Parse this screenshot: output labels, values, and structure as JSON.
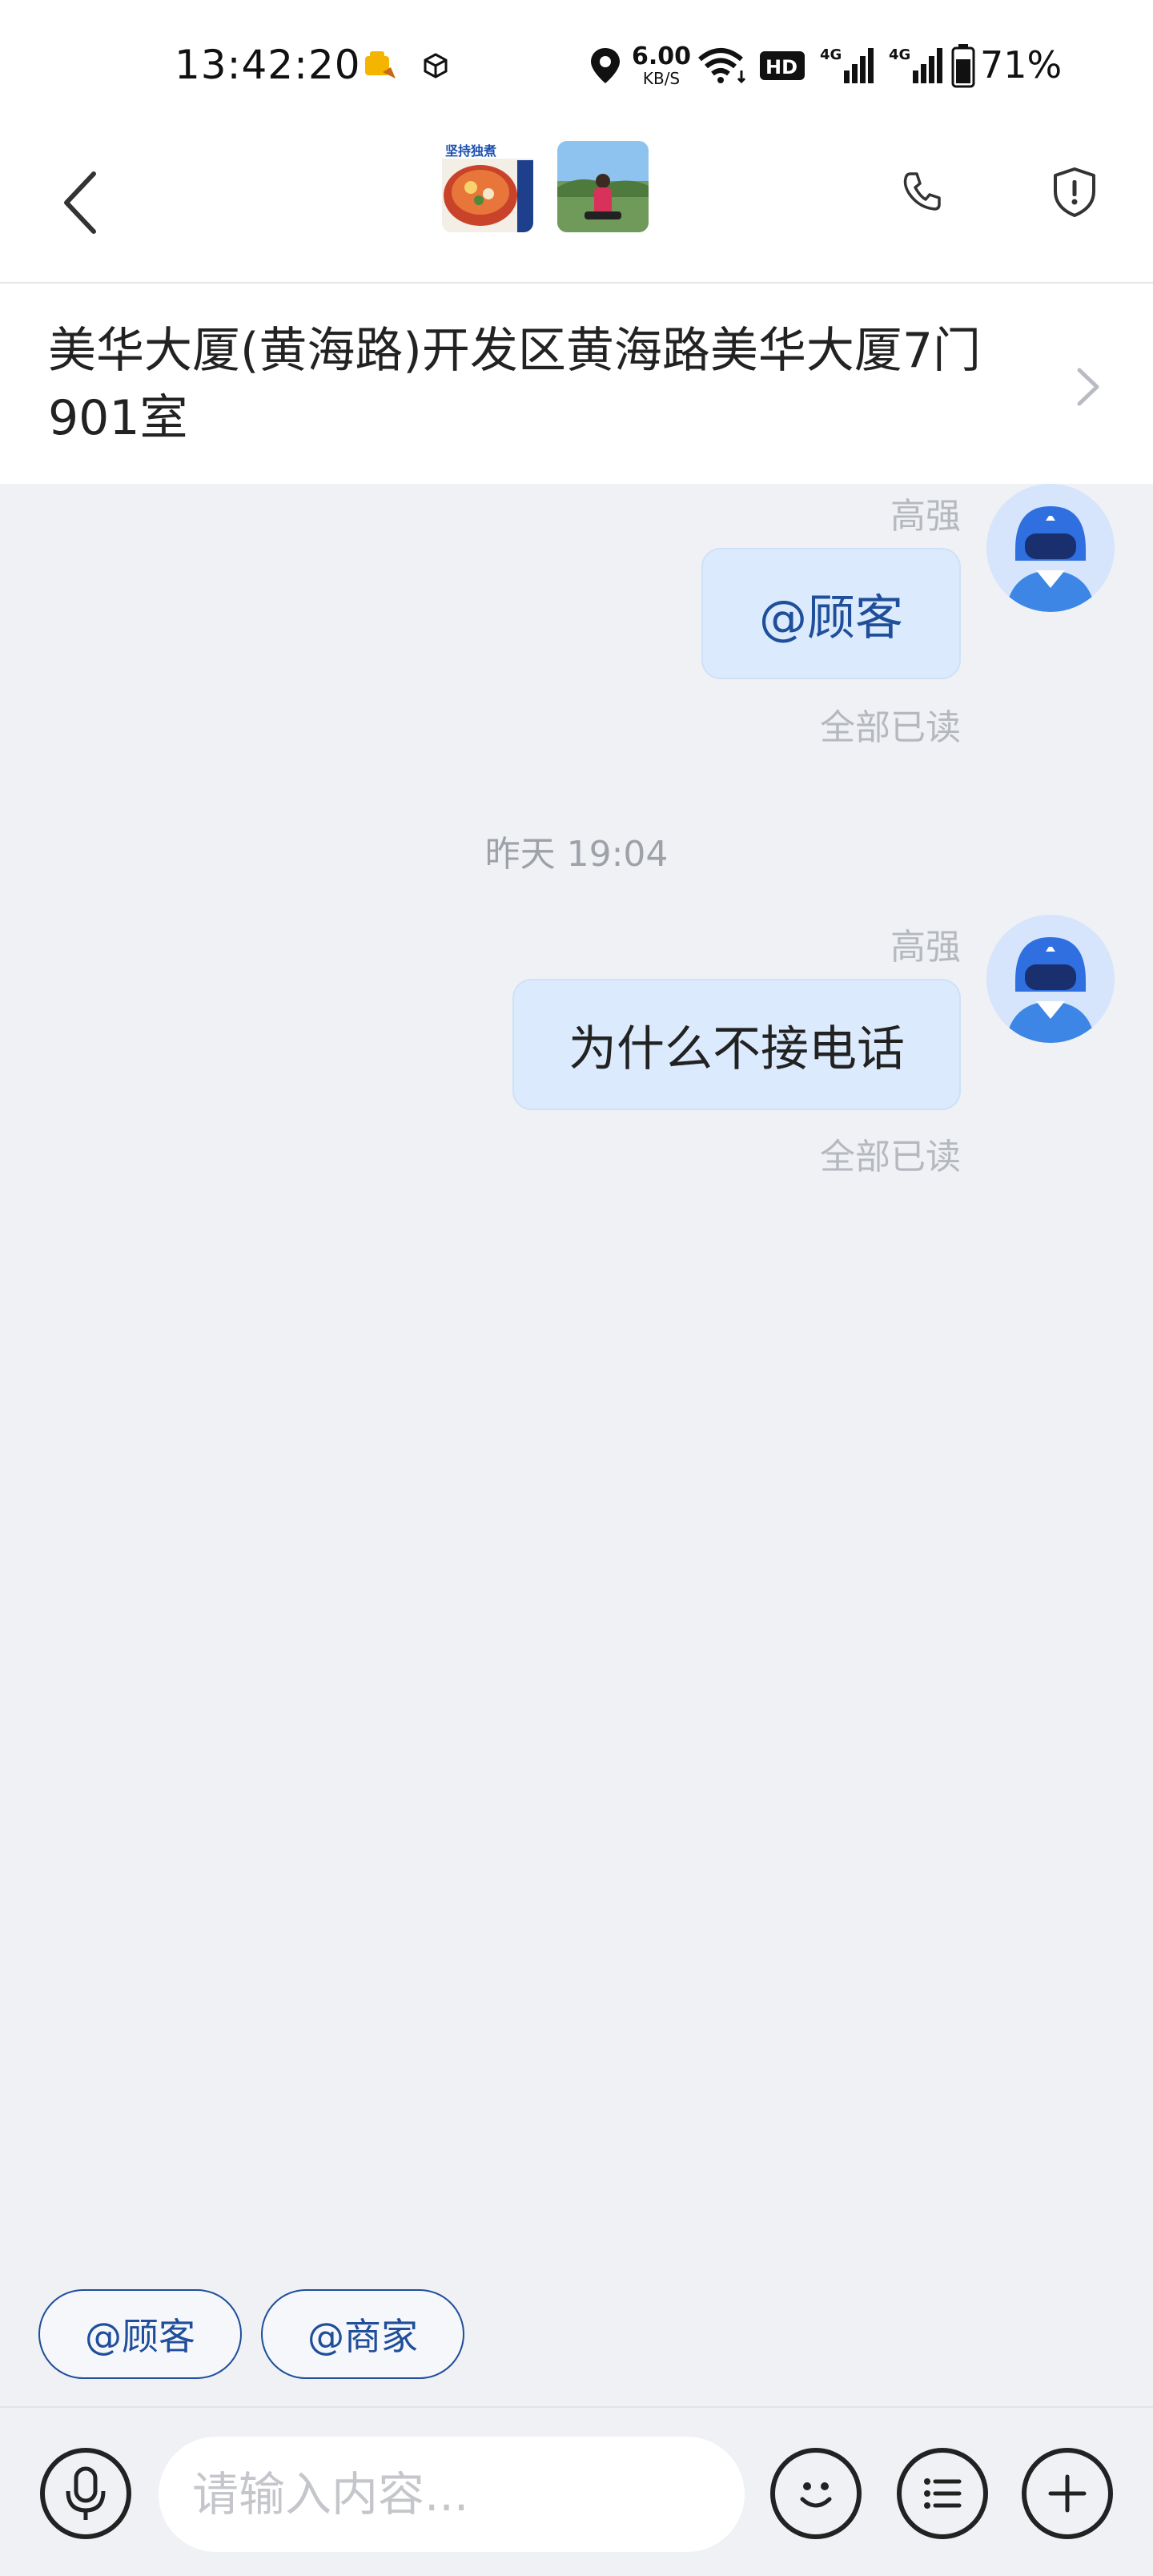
{
  "status_bar": {
    "time": "13:42:20",
    "network_speed_value": "6.00",
    "network_speed_unit": "KB/S",
    "hd_label": "HD",
    "signal_1_label": "4G",
    "signal_2_label": "4G",
    "battery_text": "71%"
  },
  "header": {
    "food_avatar_text": "坚持独煮",
    "back_icon": "chevron-left-icon",
    "phone_icon": "phone-icon",
    "shield_icon": "shield-alert-icon"
  },
  "address": {
    "text": "美华大厦(黄海路)开发区黄海路美华大厦7门901室"
  },
  "messages": [
    {
      "sender": "高强",
      "text": "@顾客",
      "read_status": "全部已读"
    },
    {
      "sender": "高强",
      "text": "为什么不接电话",
      "read_status": "全部已读"
    }
  ],
  "time_divider": "昨天 19:04",
  "quick_mentions": [
    "@顾客",
    "@商家"
  ],
  "input_bar": {
    "placeholder": "请输入内容...",
    "voice_icon": "microphone-icon",
    "emoji_icon": "smiley-icon",
    "menu_icon": "list-icon",
    "add_icon": "plus-icon"
  },
  "colors": {
    "accent": "#1f4e9a",
    "bubble": "#dbeafc",
    "background": "#eff1f5",
    "muted_text": "#b5b8be"
  }
}
